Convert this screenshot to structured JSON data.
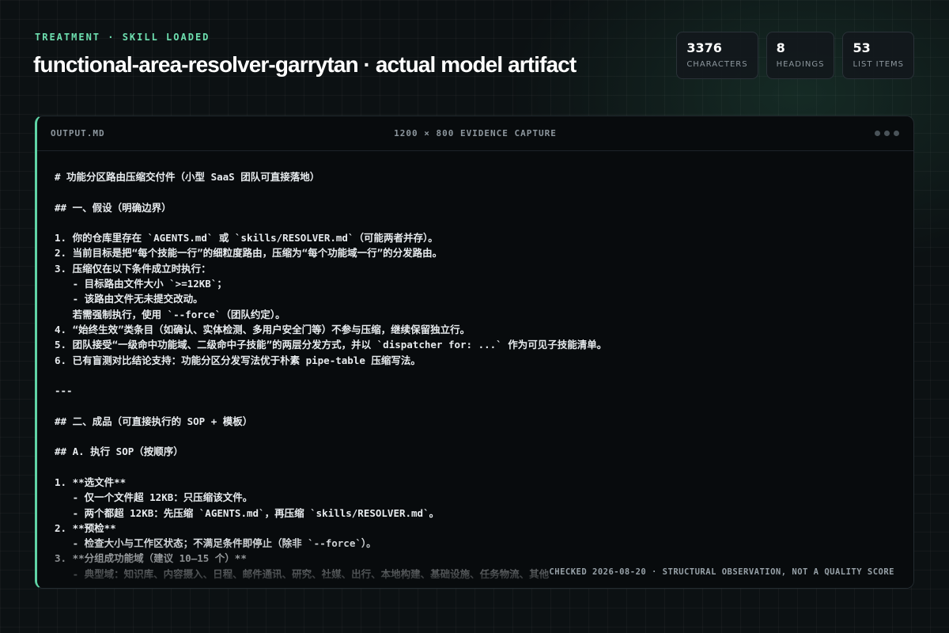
{
  "header": {
    "eyebrow": "TREATMENT · SKILL LOADED",
    "title": "functional-area-resolver-garrytan · actual model artifact"
  },
  "stats": [
    {
      "value": "3376",
      "label": "CHARACTERS"
    },
    {
      "value": "8",
      "label": "HEADINGS"
    },
    {
      "value": "53",
      "label": "LIST ITEMS"
    }
  ],
  "panel": {
    "file_name": "OUTPUT.MD",
    "capture_label": "1200 × 800 EVIDENCE CAPTURE",
    "lines": [
      "# 功能分区路由压缩交付件（小型 SaaS 团队可直接落地）",
      "",
      "## 一、假设（明确边界）",
      "",
      "1. 你的仓库里存在 `AGENTS.md` 或 `skills/RESOLVER.md`（可能两者并存）。",
      "2. 当前目标是把“每个技能一行”的细粒度路由，压缩为“每个功能域一行”的分发路由。",
      "3. 压缩仅在以下条件成立时执行：",
      "   - 目标路由文件大小 `>=12KB`；",
      "   - 该路由文件无未提交改动。",
      "   若需强制执行，使用 `--force`（团队约定）。",
      "4. “始终生效”类条目（如确认、实体检测、多用户安全门等）不参与压缩，继续保留独立行。",
      "5. 团队接受“一级命中功能域、二级命中子技能”的两层分发方式，并以 `dispatcher for: ...` 作为可见子技能清单。",
      "6. 已有盲测对比结论支持：功能分区分发写法优于朴素 pipe-table 压缩写法。",
      "",
      "---",
      "",
      "## 二、成品（可直接执行的 SOP + 模板）",
      "",
      "## A. 执行 SOP（按顺序）",
      "",
      "1. **选文件**",
      "   - 仅一个文件超 12KB：只压缩该文件。",
      "   - 两个都超 12KB：先压缩 `AGENTS.md`，再压缩 `skills/RESOLVER.md`。",
      "2. **预检**",
      "   - 检查大小与工作区状态；不满足条件即停止（除非 `--force`）。",
      "3. **分组成功能域（建议 10–15 个）**",
      "   - 典型域：知识库、内容摄入、日程、邮件通讯、研究、社媒、出行、本地构建、基础设施、任务物流、其他"
    ],
    "footer_note": "CHECKED 2026-08-20 · STRUCTURAL OBSERVATION, NOT A QUALITY SCORE"
  }
}
